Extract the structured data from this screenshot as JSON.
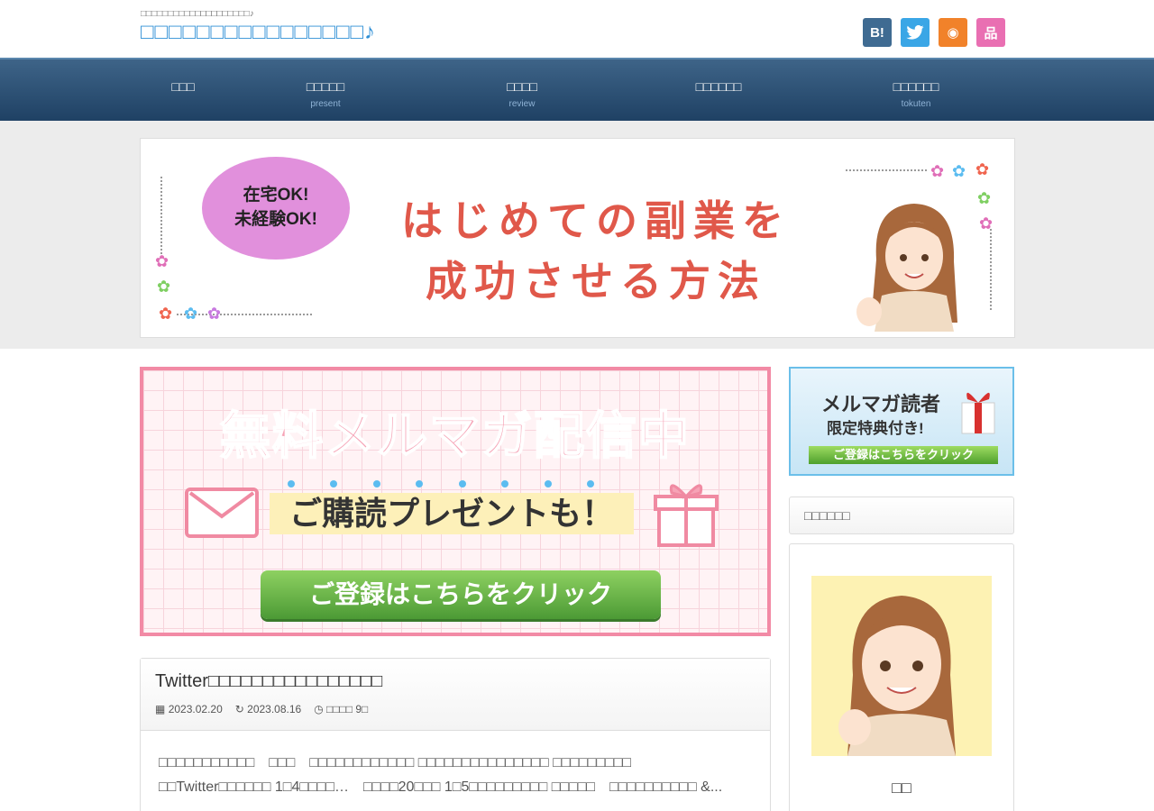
{
  "header": {
    "tagline": "□□□□□□□□□□□□□□□□□□□□♪",
    "site_title": "□□□□□□□□□□□□□□□□♪"
  },
  "social": {
    "hatena_label": "B!",
    "rss_label": "◉",
    "sitemap_label": "品"
  },
  "nav": {
    "items": [
      {
        "label": "□□□",
        "sub": ""
      },
      {
        "label": "□□□□□",
        "sub": "present"
      },
      {
        "label": "□□□□",
        "sub": "review"
      },
      {
        "label": "□□□□□□",
        "sub": ""
      },
      {
        "label": "□□□□□□",
        "sub": "tokuten"
      }
    ]
  },
  "hero": {
    "bubble_line1": "在宅OK!",
    "bubble_line2": "未経験OK!",
    "title_line1": "はじめての副業を",
    "title_line2": "成功させる方法"
  },
  "banner": {
    "title": "無料メルマガ配信中",
    "subtitle": "ご購読プレゼントも！",
    "button": "ご登録はこちらをクリック"
  },
  "post": {
    "title": "Twitter□□□□□□□□□□□□□□□□",
    "published": "2023.02.20",
    "updated": "2023.08.16",
    "read_time": "□□□□ 9□",
    "excerpt": "□□□□□□□□□□□　□□□　□□□□□□□□□□□□ □□□□□□□□□□□□□□□ □□□□□□□□□　□□Twitter□□□□□□ 1□4□□□□…　□□□□20□□□ 1□5□□□□□□□□□ □□□□□　□□□□□□□□□□ &..."
  },
  "sidebar": {
    "banner_line1": "メルマガ読者",
    "banner_line2": "限定特典付き!",
    "banner_button": "ご登録はこちらをクリック",
    "widget_title": "□□□□□□",
    "profile_name": "□□"
  },
  "colors": {
    "title_blue": "#2e8fd6",
    "nav_dark": "#1f4164",
    "banner_pink": "#f28aa5",
    "button_green": "#5aa83a"
  }
}
